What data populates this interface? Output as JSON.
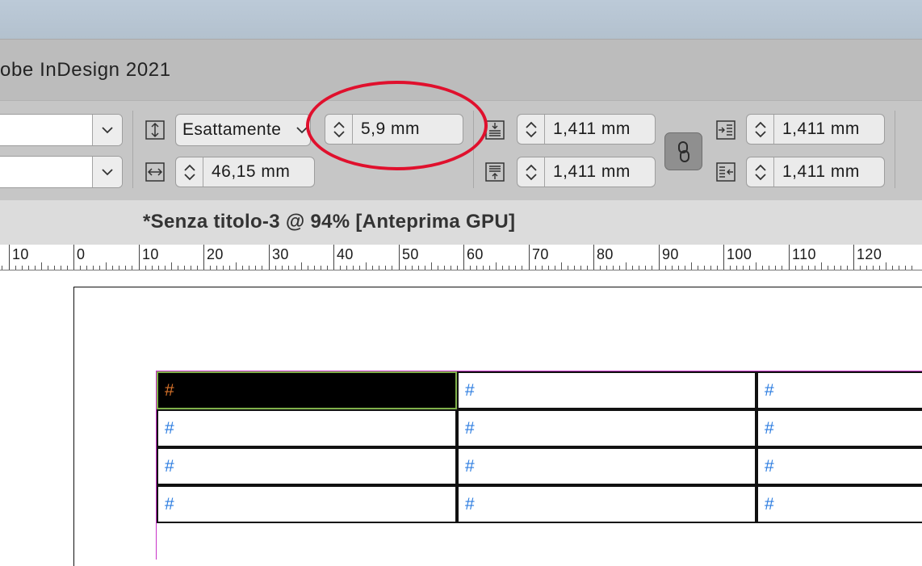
{
  "app": {
    "title": "obe InDesign 2021"
  },
  "control_panel": {
    "font_family_value": "",
    "font_style_value": "",
    "leading_type": "Esattamente",
    "row_height": "5,9 mm",
    "column_width": "46,15 mm",
    "inset_top": "1,411 mm",
    "inset_bottom": "1,411 mm",
    "inset_left": "1,411 mm",
    "inset_right": "1,411 mm"
  },
  "document": {
    "tab_title": "*Senza titolo-3 @ 94% [Anteprima GPU]"
  },
  "ruler": {
    "labels": [
      "10",
      "0",
      "10",
      "20",
      "30",
      "40",
      "50",
      "60",
      "70",
      "80",
      "90",
      "100",
      "110",
      "120"
    ]
  },
  "table": {
    "rows": [
      [
        "#",
        "#",
        "#"
      ],
      [
        "#",
        "#",
        "#"
      ],
      [
        "#",
        "#",
        "#"
      ],
      [
        "#",
        "#",
        "#"
      ]
    ]
  },
  "colors": {
    "highlight": "#e0102d",
    "cell_text": "#2d7de0",
    "selected_cell_text": "#d9732a",
    "frame_edge": "#c832c8"
  },
  "icons": {
    "row_height": "row-height-icon",
    "column_width": "column-width-icon",
    "inset_top": "inset-top-icon",
    "inset_bottom": "inset-bottom-icon",
    "inset_left": "inset-left-icon",
    "inset_right": "inset-right-icon",
    "link": "link-icon"
  }
}
